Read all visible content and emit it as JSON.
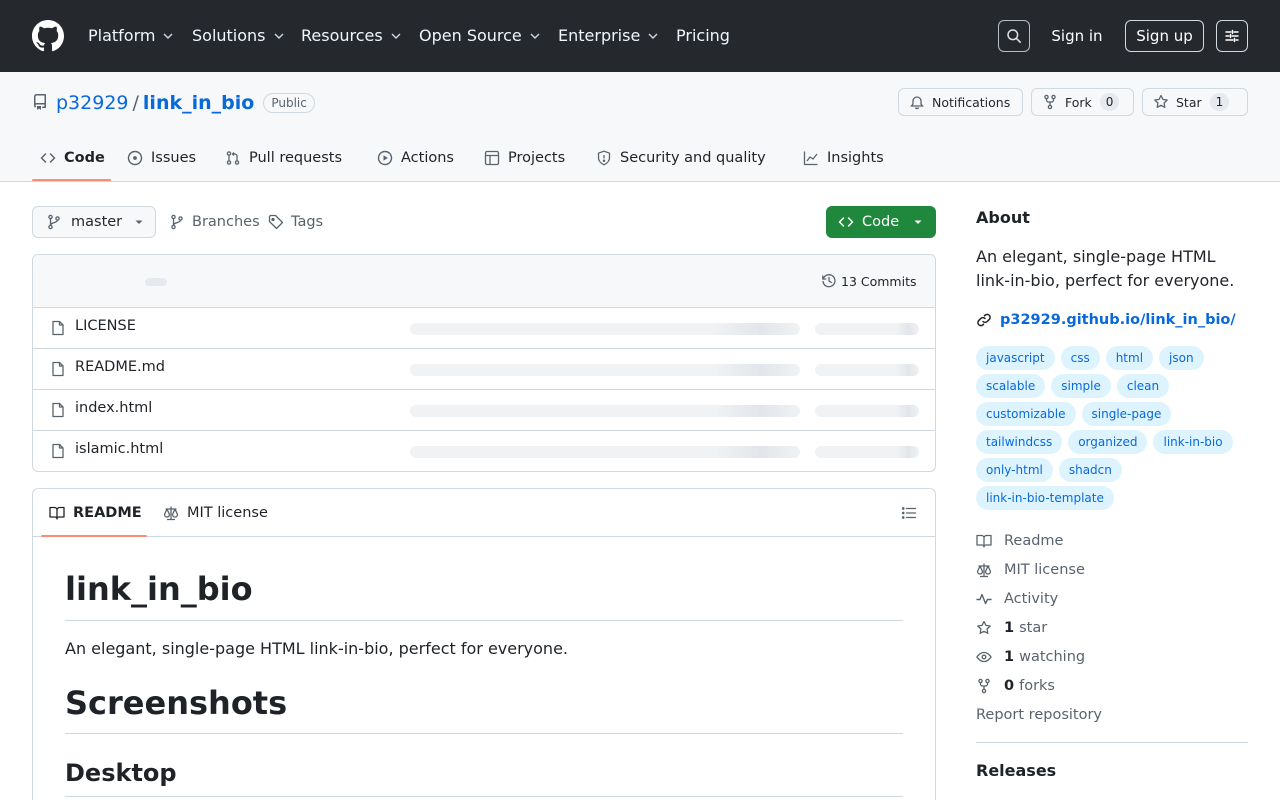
{
  "header": {
    "nav": [
      {
        "label": "Platform",
        "dropdown": true
      },
      {
        "label": "Solutions",
        "dropdown": true
      },
      {
        "label": "Resources",
        "dropdown": true
      },
      {
        "label": "Open Source",
        "dropdown": true
      },
      {
        "label": "Enterprise",
        "dropdown": true
      },
      {
        "label": "Pricing",
        "dropdown": false
      }
    ],
    "sign_in": "Sign in",
    "sign_up": "Sign up"
  },
  "repo": {
    "owner": "p32929",
    "separator": "/",
    "name": "link_in_bio",
    "visibility": "Public",
    "notifications_label": "Notifications",
    "fork_label": "Fork",
    "fork_count": "0",
    "star_label": "Star",
    "star_count": "1"
  },
  "tabs": [
    {
      "label": "Code",
      "icon": "code-icon",
      "active": true
    },
    {
      "label": "Issues",
      "icon": "issue-opened-icon",
      "active": false
    },
    {
      "label": "Pull requests",
      "icon": "git-pull-request-icon",
      "active": false
    },
    {
      "label": "Actions",
      "icon": "play-icon",
      "active": false
    },
    {
      "label": "Projects",
      "icon": "table-icon",
      "active": false
    },
    {
      "label": "Security and quality",
      "icon": "shield-icon",
      "active": false
    },
    {
      "label": "Insights",
      "icon": "graph-icon",
      "active": false
    }
  ],
  "branch_bar": {
    "branch": "master",
    "branches_label": "Branches",
    "tags_label": "Tags",
    "code_button": "Code"
  },
  "files": {
    "commits_label": "13 Commits",
    "rows": [
      {
        "name": "LICENSE"
      },
      {
        "name": "README.md"
      },
      {
        "name": "index.html"
      },
      {
        "name": "islamic.html"
      }
    ]
  },
  "readme": {
    "tab_readme": "README",
    "tab_license": "MIT license",
    "h1": "link_in_bio",
    "intro": "An elegant, single-page HTML link-in-bio, perfect for everyone.",
    "h2": "Screenshots",
    "h3": "Desktop"
  },
  "sidebar": {
    "about_title": "About",
    "description": "An elegant, single-page HTML link-in-bio, perfect for everyone.",
    "homepage": "p32929.github.io/link_in_bio/",
    "topics": [
      "javascript",
      "css",
      "html",
      "json",
      "scalable",
      "simple",
      "clean",
      "customizable",
      "single-page",
      "tailwindcss",
      "organized",
      "link-in-bio",
      "only-html",
      "shadcn",
      "link-in-bio-template"
    ],
    "links": {
      "readme": "Readme",
      "license": "MIT license",
      "activity": "Activity",
      "stars_count": "1",
      "stars_label": "star",
      "watching_count": "1",
      "watching_label": "watching",
      "forks_count": "0",
      "forks_label": "forks"
    },
    "report": "Report repository",
    "releases_title": "Releases"
  },
  "colors": {
    "header_bg": "#25292e",
    "link_blue": "#0969da",
    "primary_green": "#1f883d",
    "tab_underline": "#fd8c73",
    "topic_bg": "#ddf4ff"
  }
}
